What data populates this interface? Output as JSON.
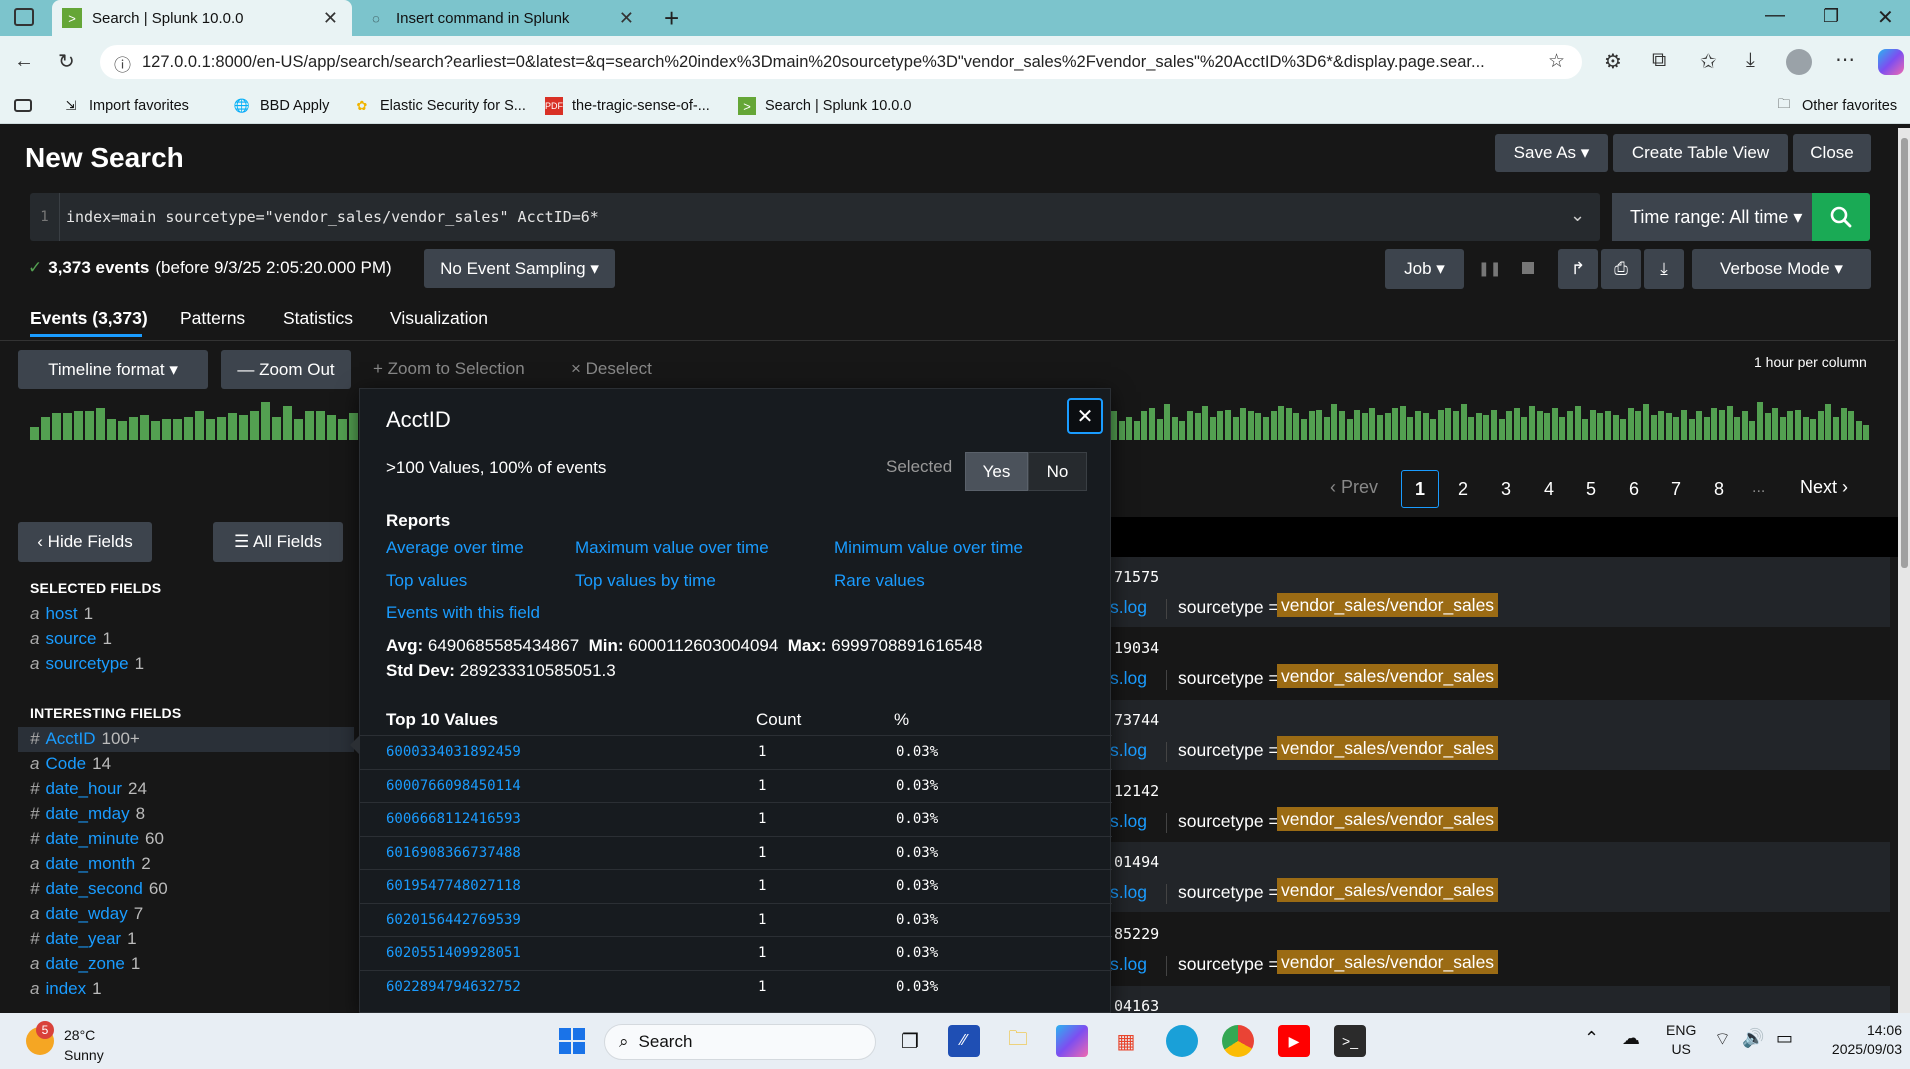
{
  "browser": {
    "tabs": [
      {
        "label": "Search | Splunk 10.0.0",
        "active": true
      },
      {
        "label": "Insert command in Splunk",
        "active": false
      }
    ],
    "url": "127.0.0.1:8000/en-US/app/search/search?earliest=0&latest=&q=search%20index%3Dmain%20sourcetype%3D\"vendor_sales%2Fvendor_sales\"%20AcctID%3D6*&display.page.sear...",
    "bookmarks": [
      "Import favorites",
      "BBD Apply",
      "Elastic Security for S...",
      "the-tragic-sense-of-...",
      "Search | Splunk 10.0.0"
    ],
    "other_favorites": "Other favorites"
  },
  "splunk": {
    "page_title": "New Search",
    "save_as": "Save As ▾",
    "create_table_view": "Create Table View",
    "close": "Close",
    "line_number": "1",
    "query": "index=main sourcetype=\"vendor_sales/vendor_sales\" AcctID=6*",
    "time_range": "Time range: All time ▾",
    "events_count_bold": "3,373 events",
    "events_count_rest": "(before 9/3/25 2:05:20.000 PM)",
    "sampling": "No Event Sampling ▾",
    "job": "Job ▾",
    "verbose_mode": "Verbose Mode ▾",
    "tabs": [
      "Events (3,373)",
      "Patterns",
      "Statistics",
      "Visualization"
    ],
    "timeline_format": "Timeline format ▾",
    "zoom_out": "— Zoom Out",
    "zoom_selection": "+ Zoom to Selection",
    "deselect": "× Deselect",
    "per_column": "1 hour per column",
    "pagination": {
      "prev": "‹ Prev",
      "pages": [
        "1",
        "2",
        "3",
        "4",
        "5",
        "6",
        "7",
        "8"
      ],
      "ellipsis": "...",
      "next": "Next ›",
      "current": 1
    },
    "hide_fields": "‹ Hide Fields",
    "all_fields": "☰ All Fields",
    "selected_fields_heading": "SELECTED FIELDS",
    "selected_fields": [
      {
        "type": "a",
        "name": "host",
        "count": "1"
      },
      {
        "type": "a",
        "name": "source",
        "count": "1"
      },
      {
        "type": "a",
        "name": "sourcetype",
        "count": "1"
      }
    ],
    "interesting_fields_heading": "INTERESTING FIELDS",
    "interesting_fields": [
      {
        "type": "#",
        "name": "AcctID",
        "count": "100+"
      },
      {
        "type": "a",
        "name": "Code",
        "count": "14"
      },
      {
        "type": "#",
        "name": "date_hour",
        "count": "24"
      },
      {
        "type": "#",
        "name": "date_mday",
        "count": "8"
      },
      {
        "type": "#",
        "name": "date_minute",
        "count": "60"
      },
      {
        "type": "a",
        "name": "date_month",
        "count": "2"
      },
      {
        "type": "#",
        "name": "date_second",
        "count": "60"
      },
      {
        "type": "a",
        "name": "date_wday",
        "count": "7"
      },
      {
        "type": "#",
        "name": "date_year",
        "count": "1"
      },
      {
        "type": "a",
        "name": "date_zone",
        "count": "1"
      },
      {
        "type": "a",
        "name": "index",
        "count": "1"
      }
    ],
    "events": [
      {
        "id_tail": "71575",
        "src_tail": "s.log",
        "st_label": "sourcetype =",
        "st_value": "vendor_sales/vendor_sales"
      },
      {
        "id_tail": "19034",
        "src_tail": "s.log",
        "st_label": "sourcetype =",
        "st_value": "vendor_sales/vendor_sales"
      },
      {
        "id_tail": "73744",
        "src_tail": "s.log",
        "st_label": "sourcetype =",
        "st_value": "vendor_sales/vendor_sales"
      },
      {
        "id_tail": "12142",
        "src_tail": "s.log",
        "st_label": "sourcetype =",
        "st_value": "vendor_sales/vendor_sales"
      },
      {
        "id_tail": "01494",
        "src_tail": "s.log",
        "st_label": "sourcetype =",
        "st_value": "vendor_sales/vendor_sales"
      },
      {
        "id_tail": "85229",
        "src_tail": "s.log",
        "st_label": "sourcetype =",
        "st_value": "vendor_sales/vendor_sales"
      },
      {
        "id_tail": "04163",
        "src_tail": "",
        "st_label": "",
        "st_value": ""
      }
    ],
    "histogram_left": [
      0.35,
      0.6,
      0.7,
      0.7,
      0.75,
      0.75,
      0.85,
      0.55,
      0.5,
      0.6,
      0.65,
      0.5,
      0.55,
      0.55,
      0.6,
      0.75,
      0.55,
      0.6,
      0.7,
      0.65,
      0.75,
      1.0,
      0.6,
      0.9,
      0.55,
      0.75,
      0.75,
      0.65,
      0.55,
      0.7
    ],
    "histogram_right": [
      0.75,
      0.5,
      0.6,
      0.5,
      0.75,
      0.85,
      0.55,
      0.95,
      0.6,
      0.5,
      0.75,
      0.7,
      0.9,
      0.6,
      0.75,
      0.8,
      0.6,
      0.85,
      0.75,
      0.7,
      0.6,
      0.75,
      0.9,
      0.85,
      0.7,
      0.55,
      0.75,
      0.8,
      0.6,
      0.95,
      0.75,
      0.55,
      0.8,
      0.7,
      0.85,
      0.65,
      0.7,
      0.85,
      0.9,
      0.6,
      0.75,
      0.7,
      0.55,
      0.8,
      0.85,
      0.75,
      0.95,
      0.6,
      0.7,
      0.65,
      0.8,
      0.55,
      0.75,
      0.85,
      0.6,
      0.9,
      0.75,
      0.7,
      0.85,
      0.6,
      0.75,
      0.9,
      0.55,
      0.8,
      0.7,
      0.75,
      0.65,
      0.55,
      0.85,
      0.75,
      0.95,
      0.65,
      0.75,
      0.7,
      0.6,
      0.8,
      0.55,
      0.75,
      0.6,
      0.85,
      0.8,
      0.9,
      0.6,
      0.75,
      0.5,
      1.0,
      0.7,
      0.85,
      0.6,
      0.75,
      0.8,
      0.6,
      0.55,
      0.75,
      0.95,
      0.6,
      0.85,
      0.75,
      0.5,
      0.4
    ],
    "popup": {
      "field": "AcctID",
      "summary": ">100 Values, 100% of events",
      "selected_label": "Selected",
      "yes": "Yes",
      "no": "No",
      "reports_heading": "Reports",
      "reports": [
        "Average over time",
        "Maximum value over time",
        "Minimum value over time",
        "Top values",
        "Top values by time",
        "Rare values",
        "Events with this field"
      ],
      "avg_label": "Avg:",
      "avg": "6490685585434867",
      "min_label": "Min:",
      "min": "6000112603004094",
      "max_label": "Max:",
      "max": "6999708891616548",
      "std_label": "Std Dev:",
      "std": "289233310585051.3",
      "table_headers": [
        "Top 10 Values",
        "Count",
        "%"
      ],
      "rows": [
        {
          "value": "6000334031892459",
          "count": "1",
          "pct": "0.03%"
        },
        {
          "value": "6000766098450114",
          "count": "1",
          "pct": "0.03%"
        },
        {
          "value": "6006668112416593",
          "count": "1",
          "pct": "0.03%"
        },
        {
          "value": "6016908366737488",
          "count": "1",
          "pct": "0.03%"
        },
        {
          "value": "6019547748027118",
          "count": "1",
          "pct": "0.03%"
        },
        {
          "value": "6020156442769539",
          "count": "1",
          "pct": "0.03%"
        },
        {
          "value": "6020551409928051",
          "count": "1",
          "pct": "0.03%"
        },
        {
          "value": "6022894794632752",
          "count": "1",
          "pct": "0.03%"
        }
      ]
    }
  },
  "taskbar": {
    "weather_temp": "28°C",
    "weather_desc": "Sunny",
    "weather_badge": "5",
    "search": "Search",
    "lang1": "ENG",
    "lang2": "US",
    "time": "14:06",
    "date": "2025/09/03"
  },
  "colors": {
    "accent": "#1a9cff",
    "go": "#1aaa55",
    "histogram": "#53a051",
    "highlight": "#9b6b14"
  }
}
